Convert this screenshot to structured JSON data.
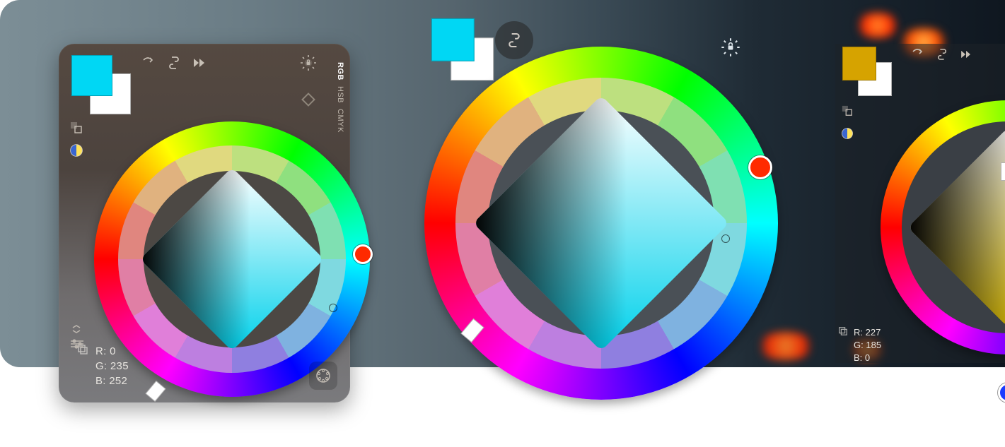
{
  "color_modes": [
    "RGB",
    "HSB",
    "CMYK"
  ],
  "panel1": {
    "foreground": "#00d7f4",
    "background": "#ffffff",
    "hue_indicator": "#ff2a00",
    "rgb": {
      "r_label": "R:",
      "g_label": "G:",
      "b_label": "B:",
      "r": "0",
      "g": "235",
      "b": "252"
    }
  },
  "center": {
    "foreground": "#00d7f4",
    "background": "#ffffff",
    "hue_indicator": "#ff2a00"
  },
  "panel3": {
    "foreground": "#d6a300",
    "background": "#ffffff",
    "hue_indicator": "#1a3bff",
    "rgb": {
      "r_label": "R:",
      "g_label": "G:",
      "b_label": "B:",
      "r": "227",
      "g": "185",
      "b": "0"
    }
  },
  "icons": {
    "swap": "swap-colors-icon",
    "link": "link-icon",
    "ffwd": "fast-forward-icon",
    "defaults": "default-swatches-icon",
    "hue_toggle": "hue-split-icon",
    "brightness_lock": "brightness-lock-icon",
    "diamond_toggle": "diamond-icon",
    "color_wheel": "color-wheel-icon",
    "sliders": "sliders-icon",
    "collapse": "collapse-icon",
    "copy": "copy-icon"
  }
}
